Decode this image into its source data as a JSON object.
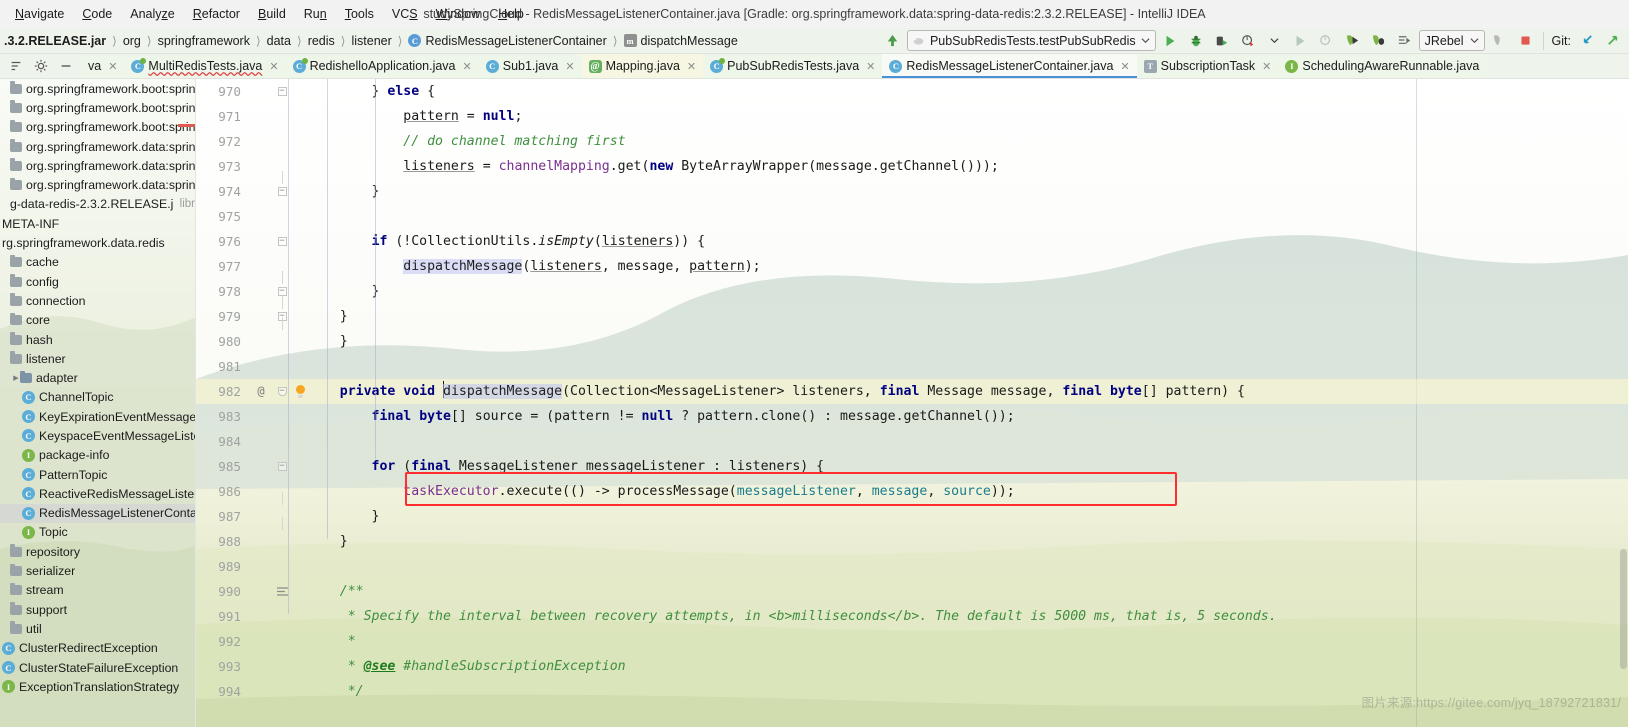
{
  "window": {
    "title": "studySpringCloud - RedisMessageListenerContainer.java [Gradle: org.springframework.data:spring-data-redis:2.3.2.RELEASE] - IntelliJ IDEA"
  },
  "menu": {
    "items": [
      {
        "label": "Navigate",
        "mnemonic": "N"
      },
      {
        "label": "Code",
        "mnemonic": "C"
      },
      {
        "label": "Analyze",
        "mnemonic": "z"
      },
      {
        "label": "Refactor",
        "mnemonic": "R"
      },
      {
        "label": "Build",
        "mnemonic": "B"
      },
      {
        "label": "Run",
        "mnemonic": "n"
      },
      {
        "label": "Tools",
        "mnemonic": "T"
      },
      {
        "label": "VCS",
        "mnemonic": "S"
      },
      {
        "label": "Window",
        "mnemonic": "W"
      },
      {
        "label": "Help",
        "mnemonic": "H"
      }
    ]
  },
  "breadcrumbs": [
    {
      "label": ".3.2.RELEASE.jar",
      "icon": "jar-icon",
      "bold": true
    },
    {
      "label": "org",
      "icon": "package-icon",
      "bold": false
    },
    {
      "label": "springframework",
      "icon": "package-icon",
      "bold": false
    },
    {
      "label": "data",
      "icon": "package-icon",
      "bold": false
    },
    {
      "label": "redis",
      "icon": "package-icon",
      "bold": false
    },
    {
      "label": "listener",
      "icon": "package-icon",
      "bold": false
    },
    {
      "label": "RedisMessageListenerContainer",
      "icon": "class-icon",
      "bold": false
    },
    {
      "label": "dispatchMessage",
      "icon": "method-icon",
      "bold": false
    }
  ],
  "toolbar": {
    "update_project_label": "update-project-icon",
    "run_config": "PubSubRedisTests.testPubSubRedis",
    "run_label": "run-icon",
    "debug_label": "debug-icon",
    "coverage_label": "coverage-icon",
    "profile_label": "profile-icon",
    "jrebel_label": "JRebel",
    "stop_label": "stop-icon",
    "git_label": "Git:"
  },
  "tabs": [
    {
      "label": "va",
      "icon": "class-icon",
      "kind": "class",
      "active": false,
      "clipped": true
    },
    {
      "label": "MultiRedisTests.java",
      "icon": "spring-class-icon",
      "kind": "spring",
      "active": false,
      "error": true
    },
    {
      "label": "RedishelloApplication.java",
      "icon": "spring-class-icon",
      "kind": "spring",
      "active": false
    },
    {
      "label": "Sub1.java",
      "icon": "class-icon",
      "kind": "class",
      "active": false
    },
    {
      "label": "Mapping.java",
      "icon": "annotation-icon",
      "kind": "annotation",
      "active": false
    },
    {
      "label": "PubSubRedisTests.java",
      "icon": "spring-class-icon",
      "kind": "spring",
      "active": false
    },
    {
      "label": "RedisMessageListenerContainer.java",
      "icon": "class-icon",
      "kind": "class",
      "active": true
    },
    {
      "label": "SubscriptionTask",
      "icon": "test-class-icon",
      "kind": "test",
      "active": false
    },
    {
      "label": "SchedulingAwareRunnable.java",
      "icon": "interface-icon",
      "kind": "interface",
      "active": false
    }
  ],
  "tree": {
    "rows": [
      {
        "label": "org.springframework.boot:spring-b",
        "type": "library",
        "depth": 0,
        "clipped": true
      },
      {
        "label": "org.springframework.boot:spring-b",
        "type": "library",
        "depth": 0,
        "clipped": true
      },
      {
        "label": "org.springframework.boot:spring-",
        "type": "library",
        "depth": 0,
        "clipped": true,
        "marker": "red"
      },
      {
        "label": "org.springframework.data:spring-d",
        "type": "library",
        "depth": 0,
        "clipped": true
      },
      {
        "label": "org.springframework.data:spring-d",
        "type": "library",
        "depth": 0,
        "clipped": true
      },
      {
        "label": "org.springframework.data:spring-d",
        "type": "library",
        "depth": 0,
        "clipped": true
      },
      {
        "label": "g-data-redis-2.3.2.RELEASE.jar",
        "suffix": "libr",
        "type": "jar",
        "depth": 0,
        "clipped": true
      },
      {
        "label": "META-INF",
        "type": "folder",
        "depth": 0,
        "clipped": true
      },
      {
        "label": "rg.springframework.data.redis",
        "type": "package",
        "depth": 0,
        "clipped": true
      },
      {
        "label": "cache",
        "type": "folder",
        "depth": 1
      },
      {
        "label": "config",
        "type": "folder",
        "depth": 1
      },
      {
        "label": "connection",
        "type": "folder",
        "depth": 1
      },
      {
        "label": "core",
        "type": "folder",
        "depth": 1
      },
      {
        "label": "hash",
        "type": "folder",
        "depth": 1
      },
      {
        "label": "listener",
        "type": "folder",
        "depth": 1,
        "expanded": true
      },
      {
        "label": "adapter",
        "type": "folder-blue",
        "depth": 2,
        "arrow": true
      },
      {
        "label": "ChannelTopic",
        "type": "class",
        "depth": 2
      },
      {
        "label": "KeyExpirationEventMessageLi",
        "type": "class",
        "depth": 2,
        "clipped": true
      },
      {
        "label": "KeyspaceEventMessageListen",
        "type": "class",
        "depth": 2,
        "clipped": true
      },
      {
        "label": "package-info",
        "type": "interface",
        "depth": 2
      },
      {
        "label": "PatternTopic",
        "type": "class",
        "depth": 2
      },
      {
        "label": "ReactiveRedisMessageListene",
        "type": "class",
        "depth": 2,
        "clipped": true
      },
      {
        "label": "RedisMessageListenerContain",
        "type": "class",
        "depth": 2,
        "clipped": true,
        "selected": true
      },
      {
        "label": "Topic",
        "type": "interface",
        "depth": 2
      },
      {
        "label": "repository",
        "type": "folder",
        "depth": 1
      },
      {
        "label": "serializer",
        "type": "folder",
        "depth": 1
      },
      {
        "label": "stream",
        "type": "folder",
        "depth": 1
      },
      {
        "label": "support",
        "type": "folder",
        "depth": 1
      },
      {
        "label": "util",
        "type": "folder",
        "depth": 1
      },
      {
        "label": "ClusterRedirectException",
        "type": "class",
        "depth": 0,
        "clipped": true
      },
      {
        "label": "ClusterStateFailureException",
        "type": "class",
        "depth": 0,
        "clipped": true
      },
      {
        "label": "ExceptionTranslationStrategy",
        "type": "interface",
        "depth": 0,
        "clipped": true
      }
    ]
  },
  "editor": {
    "first_line": 970,
    "lines": [
      {
        "n": 970,
        "fold": "minus",
        "indent": 2
      },
      {
        "n": 971,
        "indent": 3
      },
      {
        "n": 972,
        "indent": 3
      },
      {
        "n": 973,
        "indent": 3
      },
      {
        "n": 974,
        "fold": "minus",
        "indent": 2
      },
      {
        "n": 975,
        "indent": 0
      },
      {
        "n": 976,
        "fold": "minus",
        "indent": 2
      },
      {
        "n": 977,
        "indent": 3
      },
      {
        "n": 978,
        "indent": 2
      },
      {
        "n": 979,
        "indent": 1
      },
      {
        "n": 980,
        "indent": 1
      },
      {
        "n": 981,
        "indent": 0
      },
      {
        "n": 982,
        "fold": "minus",
        "gutter": "@",
        "bulb": true,
        "indent": 1,
        "highlight": true
      },
      {
        "n": 983,
        "indent": 2
      },
      {
        "n": 984,
        "indent": 0
      },
      {
        "n": 985,
        "fold": "minus",
        "indent": 2
      },
      {
        "n": 986,
        "indent": 3,
        "boxed": true
      },
      {
        "n": 987,
        "indent": 2
      },
      {
        "n": 988,
        "indent": 1
      },
      {
        "n": 989,
        "indent": 0
      },
      {
        "n": 990,
        "fold": "doc",
        "indent": 1
      },
      {
        "n": 991,
        "indent": 1
      },
      {
        "n": 992,
        "indent": 1
      },
      {
        "n": 993,
        "indent": 1
      },
      {
        "n": 994,
        "indent": 1
      }
    ],
    "code_text": {
      "l970": "} else {",
      "l971": "pattern = null;",
      "l972": "// do channel matching first",
      "l973": "listeners = channelMapping.get(new ByteArrayWrapper(message.getChannel()));",
      "l974": "}",
      "l975": "",
      "l976": "if (!CollectionUtils.isEmpty(listeners)) {",
      "l977": "dispatchMessage(listeners, message, pattern);",
      "l978": "}",
      "l979": "}",
      "l980": "}",
      "l981": "",
      "l982": "private void dispatchMessage(Collection<MessageListener> listeners, final Message message, final byte[] pattern) {",
      "l983": "final byte[] source = (pattern != null ? pattern.clone() : message.getChannel());",
      "l984": "",
      "l985": "for (final MessageListener messageListener : listeners) {",
      "l986": "taskExecutor.execute(() -> processMessage(messageListener, message, source));",
      "l987": "}",
      "l988": "}",
      "l989": "",
      "l990": "/**",
      "l991": "* Specify the interval between recovery attempts, in <b>milliseconds</b>. The default is 5000 ms, that is, 5 seconds.",
      "l992": "*",
      "l993": "* @see #handleSubscriptionException",
      "l994": "*/"
    },
    "annotation": {
      "type": "red-rectangle",
      "target_line": 986,
      "color": "#ff2d2d"
    },
    "watermark": "图片来源:https://gitee.com/jyq_18792721831/"
  }
}
